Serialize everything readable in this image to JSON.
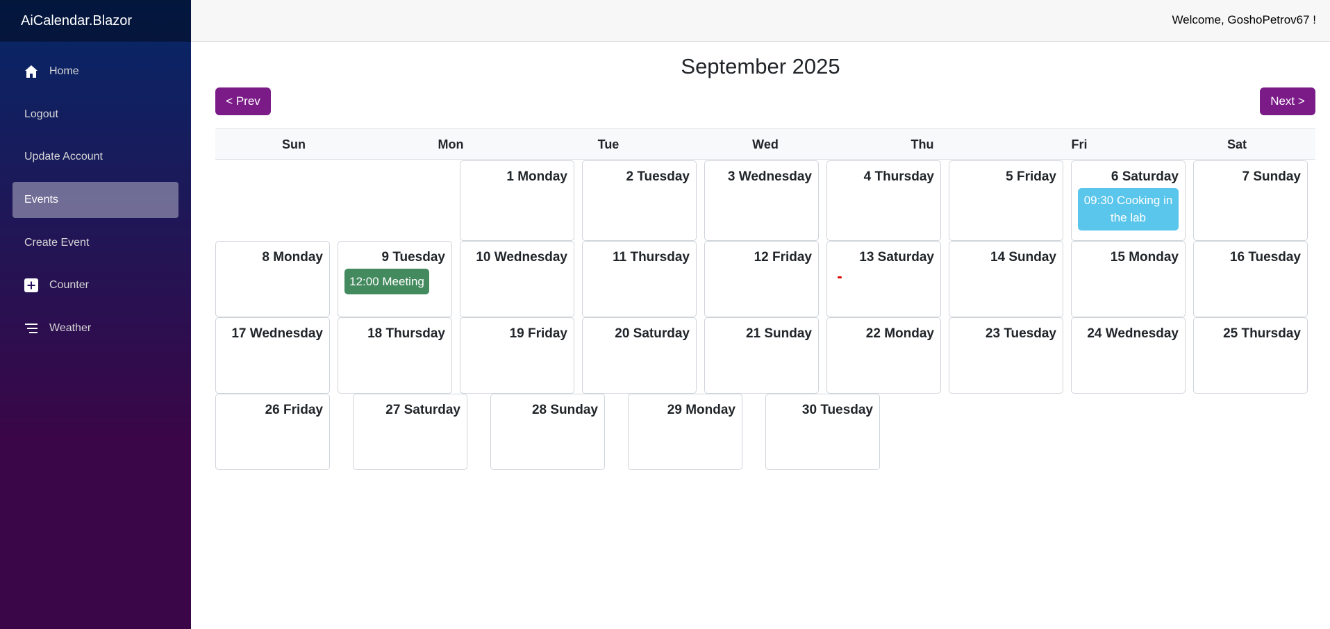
{
  "app": {
    "brand": "AiCalendar.Blazor"
  },
  "sidebar": {
    "items": [
      {
        "label": "Home",
        "icon": "home-icon"
      },
      {
        "label": "Logout",
        "icon": ""
      },
      {
        "label": "Update Account",
        "icon": ""
      },
      {
        "label": "Events",
        "icon": "",
        "active": true
      },
      {
        "label": "Create Event",
        "icon": ""
      },
      {
        "label": "Counter",
        "icon": "plus-square-icon"
      },
      {
        "label": "Weather",
        "icon": "list-icon"
      }
    ]
  },
  "header": {
    "welcome": "Welcome, GoshoPetrov67 !"
  },
  "calendar": {
    "title": "September 2025",
    "prev_label": "< Prev",
    "next_label": "Next >",
    "weekdays": [
      "Sun",
      "Mon",
      "Tue",
      "Wed",
      "Thu",
      "Fri",
      "Sat"
    ],
    "days": [
      "1 Monday",
      "2 Tuesday",
      "3 Wednesday",
      "4 Thursday",
      "5 Friday",
      "6 Saturday",
      "7 Sunday",
      "8 Monday",
      "9 Tuesday",
      "10 Wednesday",
      "11 Thursday",
      "12 Friday",
      "13 Saturday",
      "14 Sunday",
      "15 Monday",
      "16 Tuesday",
      "17 Wednesday",
      "18 Thursday",
      "19 Friday",
      "20 Saturday",
      "21 Sunday",
      "22 Monday",
      "23 Tuesday",
      "24 Wednesday",
      "25 Thursday",
      "26 Friday",
      "27 Saturday",
      "28 Sunday",
      "29 Monday",
      "30 Tuesday"
    ],
    "events": {
      "cooking": {
        "day": "6 Saturday",
        "text": "09:30 Cooking in the lab",
        "color": "#5bc6eb"
      },
      "meeting": {
        "day": "9 Tuesday",
        "text": "12:00 Meeting",
        "color": "#438a5e"
      }
    }
  },
  "colors": {
    "accent": "#7a1b87",
    "sidebar_top": "#052767",
    "sidebar_bottom": "#3a0647"
  }
}
